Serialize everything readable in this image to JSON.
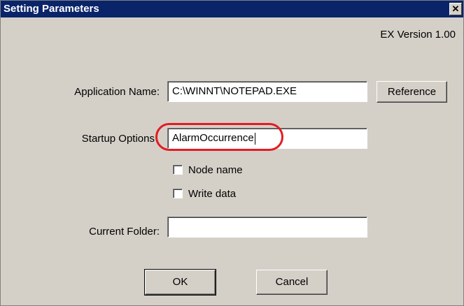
{
  "window": {
    "title": "Setting Parameters",
    "close_glyph": "✕",
    "version": "EX Version 1.00"
  },
  "form": {
    "application_name": {
      "label": "Application Name:",
      "value": "C:\\WINNT\\NOTEPAD.EXE"
    },
    "reference_button": "Reference",
    "startup_options": {
      "label": "Startup Options",
      "value": "AlarmOccurrence"
    },
    "node_name": {
      "label": "Node name",
      "checked": false
    },
    "write_data": {
      "label": "Write data",
      "checked": false
    },
    "current_folder": {
      "label": "Current Folder:",
      "value": ""
    }
  },
  "buttons": {
    "ok": "OK",
    "cancel": "Cancel"
  },
  "annotation": {
    "highlight_color": "#e41b23"
  }
}
